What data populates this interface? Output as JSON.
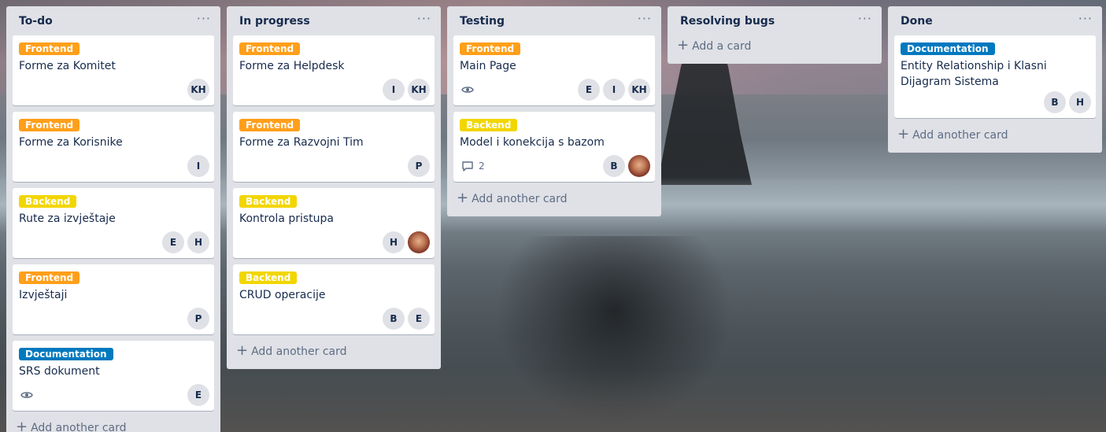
{
  "lists": [
    {
      "title": "To-do",
      "add_label": "Add another card",
      "cards": [
        {
          "label": "Frontend",
          "label_color": "#ff9f1a",
          "title": "Forme za Komitet",
          "members": [
            "KH"
          ]
        },
        {
          "label": "Frontend",
          "label_color": "#ff9f1a",
          "title": "Forme za Korisnike",
          "members": [
            "I"
          ]
        },
        {
          "label": "Backend",
          "label_color": "#f2d600",
          "title": "Rute za izvještaje",
          "members": [
            "E",
            "H"
          ]
        },
        {
          "label": "Frontend",
          "label_color": "#ff9f1a",
          "title": "Izvještaji",
          "members": [
            "P"
          ]
        },
        {
          "label": "Documentation",
          "label_color": "#0079bf",
          "title": "SRS dokument",
          "watch_icon": "eye-icon",
          "members": [
            "E"
          ]
        }
      ]
    },
    {
      "title": "In progress",
      "add_label": "Add another card",
      "cards": [
        {
          "label": "Frontend",
          "label_color": "#ff9f1a",
          "title": "Forme za Helpdesk",
          "members": [
            "I",
            "KH"
          ]
        },
        {
          "label": "Frontend",
          "label_color": "#ff9f1a",
          "title": "Forme za Razvojni Tim",
          "members": [
            "P"
          ]
        },
        {
          "label": "Backend",
          "label_color": "#f2d600",
          "title": "Kontrola pristupa",
          "members": [
            "H"
          ],
          "has_photo_avatar": true
        },
        {
          "label": "Backend",
          "label_color": "#f2d600",
          "title": "CRUD operacije",
          "members": [
            "B",
            "E"
          ]
        }
      ]
    },
    {
      "title": "Testing",
      "add_label": "Add another card",
      "cards": [
        {
          "label": "Frontend",
          "label_color": "#ff9f1a",
          "title": "Main Page",
          "watch_icon": "eye-icon",
          "members": [
            "E",
            "I",
            "KH"
          ]
        },
        {
          "label": "Backend",
          "label_color": "#f2d600",
          "title": "Model i konekcija s bazom",
          "comment_count": "2",
          "members": [
            "B"
          ],
          "has_photo_avatar": true
        }
      ]
    },
    {
      "title": "Resolving bugs",
      "add_label": "Add a card",
      "cards": []
    },
    {
      "title": "Done",
      "add_label": "Add another card",
      "cards": [
        {
          "label": "Documentation",
          "label_color": "#0079bf",
          "title": "Entity Relationship i Klasni Dijagram Sistema",
          "members": [
            "B",
            "H"
          ]
        }
      ]
    }
  ],
  "list_menu_icon": "more-horizontal-icon",
  "add_icon": "plus-icon"
}
